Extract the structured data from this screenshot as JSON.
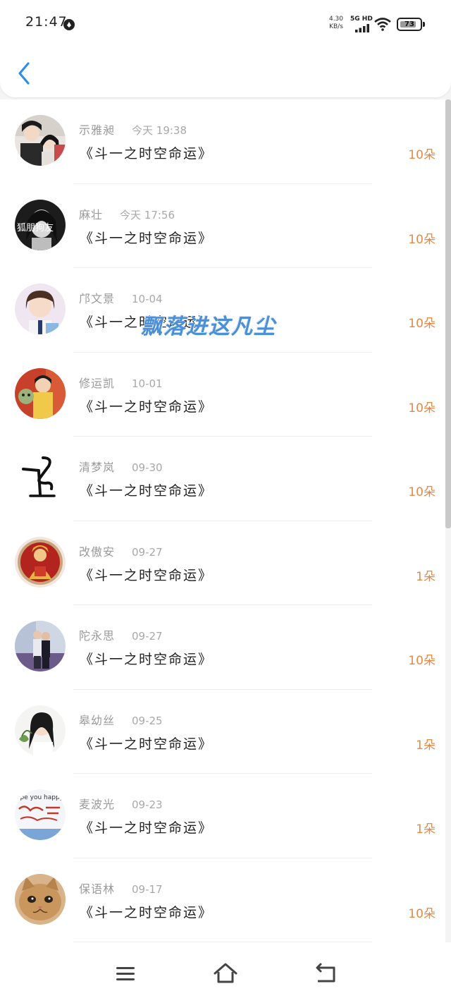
{
  "status_bar": {
    "time": "21:47",
    "net_speed_value": "4.30",
    "net_speed_unit": "KB/s",
    "signal_label": "5G HD",
    "battery": "73"
  },
  "watermark": "飘落进这凡尘",
  "list": [
    {
      "name": "示雅昶",
      "date": "今天 19:38",
      "title": "《斗一之时空命运》",
      "count": "10朵",
      "avatar": "couple-photo-avatar"
    },
    {
      "name": "麻壮",
      "date": "今天 17:56",
      "title": "《斗一之时空命运》",
      "count": "10朵",
      "avatar": "bw-portrait-avatar",
      "avatar_text": "狐朋狗友"
    },
    {
      "name": "邝文景",
      "date": "10-04",
      "title": "《斗一之时空命运》",
      "count": "10朵",
      "avatar": "girl-portrait-avatar"
    },
    {
      "name": "修运凯",
      "date": "10-01",
      "title": "《斗一之时空命运》",
      "count": "10朵",
      "avatar": "kid-photo-avatar"
    },
    {
      "name": "清梦岚",
      "date": "09-30",
      "title": "《斗一之时空命运》",
      "count": "10朵",
      "avatar": "calligraphy-avatar"
    },
    {
      "name": "改傲安",
      "date": "09-27",
      "title": "《斗一之时空命运》",
      "count": "1朵",
      "avatar": "buddha-badge-avatar"
    },
    {
      "name": "陀永思",
      "date": "09-27",
      "title": "《斗一之时空命运》",
      "count": "10朵",
      "avatar": "couple-street-avatar"
    },
    {
      "name": "皋幼丝",
      "date": "09-25",
      "title": "《斗一之时空命运》",
      "count": "1朵",
      "avatar": "girl-white-avatar"
    },
    {
      "name": "麦波光",
      "date": "09-23",
      "title": "《斗一之时空命运》",
      "count": "1朵",
      "avatar": "handwriting-avatar",
      "avatar_text": "ope you happy everyda"
    },
    {
      "name": "保语林",
      "date": "09-17",
      "title": "《斗一之时空命运》",
      "count": "10朵",
      "avatar": "kitten-avatar"
    }
  ],
  "colors": {
    "accent": "#2e8fe8",
    "count": "#e08a4a",
    "name": "#9a9a9a",
    "title": "#222222",
    "watermark": "#4a8fd8"
  },
  "nav": {
    "menu_icon": "menu-icon",
    "home_icon": "home-icon",
    "back_icon": "return-icon"
  }
}
